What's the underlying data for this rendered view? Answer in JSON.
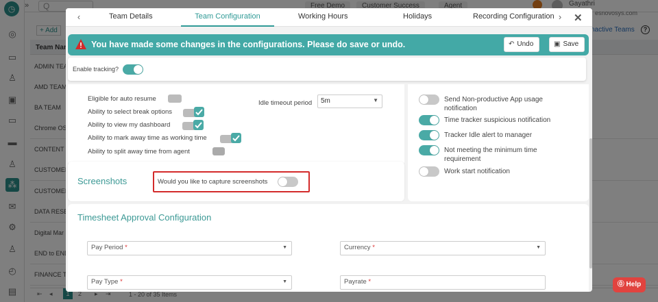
{
  "background": {
    "topbar": {
      "search_placeholder": "Q",
      "pills": [
        "Free Demo",
        "Customer Success",
        "Agent"
      ],
      "notification_count": "0",
      "user_name": "Gayathri",
      "user_email": "esnovosys.com"
    },
    "add_button": "+ Add",
    "inactive_teams_link": "nactive Teams",
    "help_circle": "?",
    "table_header": "Team Nam",
    "rows": [
      "ADMIN TEA",
      "AMD TEAM",
      "BA TEAM",
      "Chrome OS",
      "CONTENT W",
      "CUSTOMER",
      "CUSTOMER",
      "DATA RESEA",
      "Digital Mar",
      "END to END",
      "FINANCE TE"
    ],
    "pager": {
      "current_page": "1",
      "next_page": "2",
      "summary": "1 - 20 of 35 Items"
    }
  },
  "modal": {
    "tabs": [
      {
        "label": "Team Details",
        "active": false
      },
      {
        "label": "Team Configuration",
        "active": true
      },
      {
        "label": "Working Hours",
        "active": false
      },
      {
        "label": "Holidays",
        "active": false
      },
      {
        "label": "Recording Configuration",
        "active": false
      }
    ],
    "close_label": "✕",
    "alert": {
      "message": "You have made some changes in the configurations. Please do save or undo.",
      "undo_label": "Undo",
      "save_label": "Save",
      "background_color": "#43a9a6"
    },
    "enable_tracking": {
      "label": "Enable tracking?",
      "enabled": true
    },
    "tracking_options": [
      {
        "label": "Eligible for auto resume",
        "checked": false
      },
      {
        "label": "Ability to select break options",
        "checked": true
      },
      {
        "label": "Ability to view my dashboard",
        "checked": true
      },
      {
        "label": "Ability to mark away time as working time",
        "checked": true
      },
      {
        "label": "Ability to split away time from agent",
        "checked": false
      }
    ],
    "idle_timeout": {
      "label": "Idle timeout period",
      "value": "5m"
    },
    "notifications": [
      {
        "label": "Send Non-productive App usage notification",
        "enabled": false
      },
      {
        "label": "Time tracker suspicious notification",
        "enabled": true
      },
      {
        "label": "Tracker Idle alert to manager",
        "enabled": true
      },
      {
        "label": "Not meeting the minimum time requirement",
        "enabled": true
      },
      {
        "label": "Work start notification",
        "enabled": false
      }
    ],
    "screenshots": {
      "title": "Screenshots",
      "capture_label": "Would you like to capture screenshots",
      "capture_enabled": false
    },
    "timesheet": {
      "title": "Timesheet Approval Configuration",
      "pay_period": "Pay Period",
      "currency": "Currency",
      "pay_type": "Pay Type",
      "payrate": "Payrate",
      "required_marker": "*"
    }
  },
  "help_button": "Help",
  "colors": {
    "accent": "#2f9a96",
    "alert": "#43a9a6",
    "highlight_border": "#d32a2a",
    "help": "#e1433f"
  }
}
